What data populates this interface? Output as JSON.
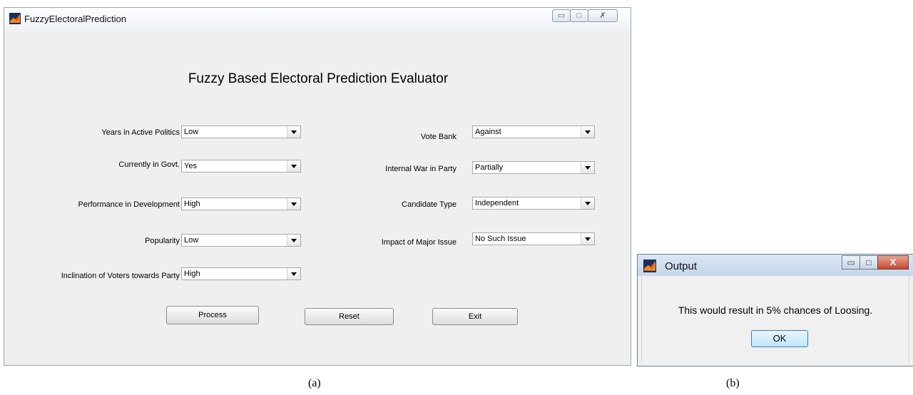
{
  "window_a": {
    "title": "FuzzyElectoralPrediction",
    "heading": "Fuzzy Based Electoral Prediction Evaluator",
    "caption_buttons": {
      "minimize": "minimize-icon",
      "maximize": "maximize-icon",
      "close": "close-icon"
    },
    "left_fields": [
      {
        "label": "Years in Active Politics",
        "value": "Low"
      },
      {
        "label": "Currently in Govt.",
        "value": "Yes"
      },
      {
        "label": "Performance in Development",
        "value": "High"
      },
      {
        "label": "Popularity",
        "value": "Low"
      },
      {
        "label": "Inclination of Voters towards Party",
        "value": "High"
      }
    ],
    "right_fields": [
      {
        "label": "Vote Bank",
        "value": "Against"
      },
      {
        "label": "Internal War in Party",
        "value": "Partially"
      },
      {
        "label": "Candidate Type",
        "value": "Independent"
      },
      {
        "label": "Impact of Major Issue",
        "value": "No Such Issue"
      }
    ],
    "buttons": {
      "process": "Process",
      "reset": "Reset",
      "exit": "Exit"
    }
  },
  "window_b": {
    "title": "Output",
    "message": "This would result in 5% chances of Loosing.",
    "ok": "OK"
  },
  "captions": {
    "a": "(a)",
    "b": "(b)"
  },
  "colors": {
    "window_bg": "#efefef",
    "dialog_close": "#c64a33",
    "ok_border": "#3c7fb1"
  }
}
